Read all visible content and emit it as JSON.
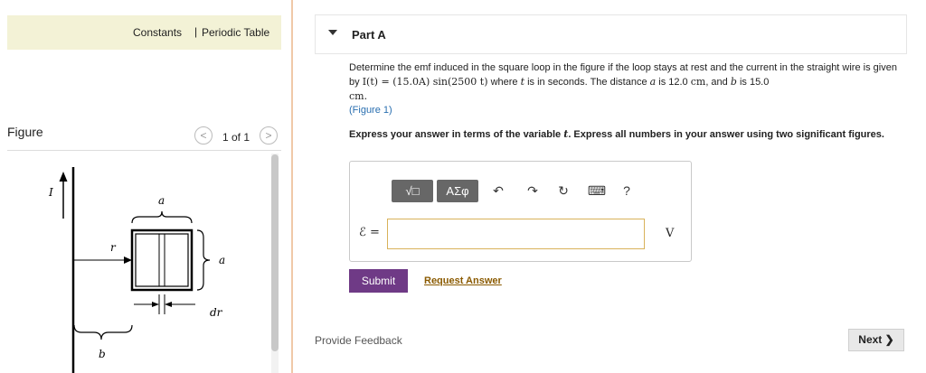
{
  "sidebar": {
    "constants_label": "Constants",
    "separator": "|",
    "periodic_table_label": "Periodic Table",
    "figure_label": "Figure",
    "pager_text": "1 of 1",
    "prev_glyph": "<",
    "next_glyph": ">"
  },
  "figure": {
    "current_label": "I",
    "top_width_label": "a",
    "side_height_label": "a",
    "distance_label": "r",
    "strip_label": "dr",
    "bottom_label": "b"
  },
  "part": {
    "title": "Part A"
  },
  "question": {
    "intro": "Determine the emf induced in the square loop in the figure if the loop stays at rest and the current in the straight wire is given by ",
    "current_expr": "I(t) = (15.0A) sin(2500 t)",
    "where": " where ",
    "var_t": "t",
    "rest": " is in seconds. The distance ",
    "var_a": "a",
    "is1": " is 12.0 ",
    "unit_cm_1": "cm",
    "and_b": ", and ",
    "var_b": "b",
    "is2": " is 15.0",
    "unit_cm_2": "cm.",
    "figure_link": "(Figure 1)"
  },
  "instructions": {
    "text_before": "Express your answer in terms of the variable ",
    "var": "t",
    "text_after": ". Express all numbers in your answer using two significant figures."
  },
  "toolbar": {
    "templates_label": "√□",
    "symbols_label": "ΑΣφ",
    "undo_icon": "↶",
    "redo_icon": "↷",
    "reset_icon": "↻",
    "keyboard_icon": "⌨",
    "help_label": "?"
  },
  "answer": {
    "symbol": "ℰ =",
    "value": "",
    "unit": "V"
  },
  "actions": {
    "submit_label": "Submit",
    "request_label": "Request Answer",
    "feedback_label": "Provide Feedback",
    "next_label": "Next ❯"
  },
  "colors": {
    "submit_bg": "#6f3a86",
    "constants_bar": "#f3f2d6",
    "divider": "#f0c9a8"
  }
}
